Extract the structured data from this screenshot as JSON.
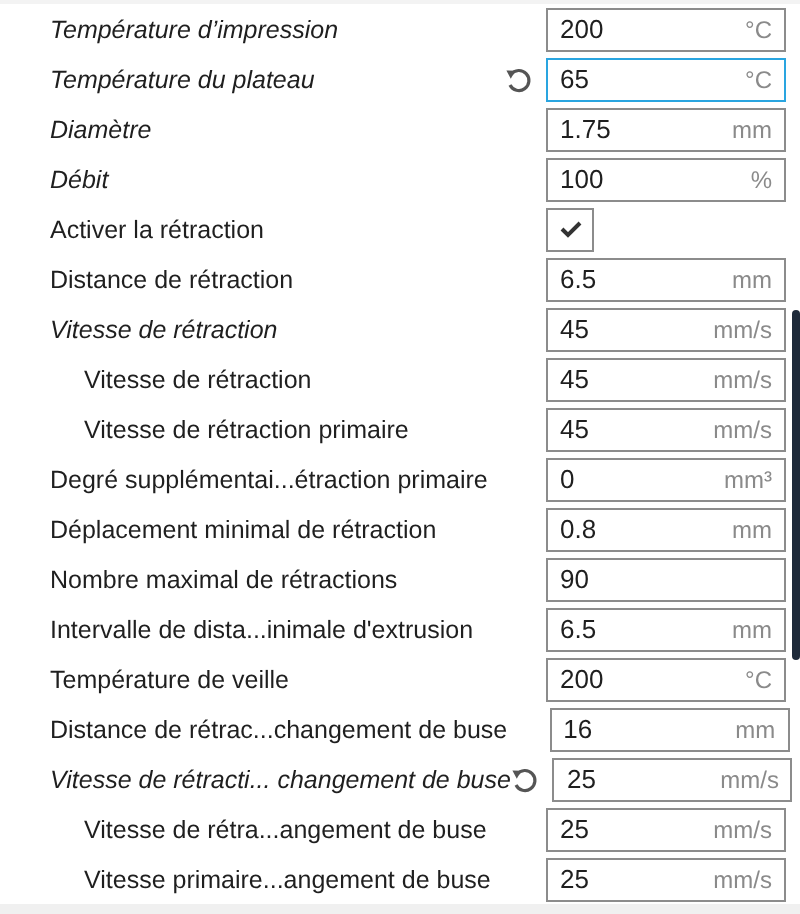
{
  "settings": [
    {
      "label": "Température d’impression",
      "kind": "field",
      "italic": true,
      "reset": false,
      "focused": false,
      "value": "200",
      "unit": "°C"
    },
    {
      "label": "Température du plateau",
      "kind": "field",
      "italic": true,
      "reset": true,
      "focused": true,
      "value": "65",
      "unit": "°C"
    },
    {
      "label": "Diamètre",
      "kind": "field",
      "italic": true,
      "reset": false,
      "focused": false,
      "value": "1.75",
      "unit": "mm"
    },
    {
      "label": "Débit",
      "kind": "field",
      "italic": true,
      "reset": false,
      "focused": false,
      "value": "100",
      "unit": "%"
    },
    {
      "label": "Activer la rétraction",
      "kind": "checkbox",
      "italic": false,
      "reset": false,
      "checked": true
    },
    {
      "label": "Distance de rétraction",
      "kind": "field",
      "italic": false,
      "reset": false,
      "focused": false,
      "value": "6.5",
      "unit": "mm"
    },
    {
      "label": "Vitesse de rétraction",
      "kind": "field",
      "italic": true,
      "reset": false,
      "focused": false,
      "value": "45",
      "unit": "mm/s",
      "children": [
        {
          "label": "Vitesse de rétraction",
          "kind": "field",
          "italic": false,
          "reset": false,
          "focused": false,
          "value": "45",
          "unit": "mm/s"
        },
        {
          "label": "Vitesse de rétraction primaire",
          "kind": "field",
          "italic": false,
          "reset": false,
          "focused": false,
          "value": "45",
          "unit": "mm/s"
        }
      ]
    },
    {
      "label": "Degré supplémentai...étraction primaire",
      "kind": "field",
      "italic": false,
      "reset": false,
      "focused": false,
      "value": "0",
      "unit": "mm³"
    },
    {
      "label": "Déplacement minimal de rétraction",
      "kind": "field",
      "italic": false,
      "reset": false,
      "focused": false,
      "value": "0.8",
      "unit": "mm"
    },
    {
      "label": "Nombre maximal de rétractions",
      "kind": "field",
      "italic": false,
      "reset": false,
      "focused": false,
      "value": "90"
    },
    {
      "label": "Intervalle de dista...inimale d'extrusion",
      "kind": "field",
      "italic": false,
      "reset": false,
      "focused": false,
      "value": "6.5",
      "unit": "mm"
    },
    {
      "label": "Température de veille",
      "kind": "field",
      "italic": false,
      "reset": false,
      "focused": false,
      "value": "200",
      "unit": "°C"
    },
    {
      "label": "Distance de rétrac...changement de buse",
      "kind": "field",
      "italic": false,
      "reset": false,
      "focused": false,
      "value": "16",
      "unit": "mm"
    },
    {
      "label": "Vitesse de rétracti... changement de buse",
      "kind": "field",
      "italic": true,
      "reset": true,
      "focused": false,
      "value": "25",
      "unit": "mm/s",
      "children": [
        {
          "label": "Vitesse de rétra...angement de buse",
          "kind": "field",
          "italic": false,
          "reset": false,
          "focused": false,
          "value": "25",
          "unit": "mm/s"
        },
        {
          "label": "Vitesse primaire...angement de buse",
          "kind": "field",
          "italic": false,
          "reset": false,
          "focused": false,
          "value": "25",
          "unit": "mm/s"
        }
      ]
    }
  ]
}
